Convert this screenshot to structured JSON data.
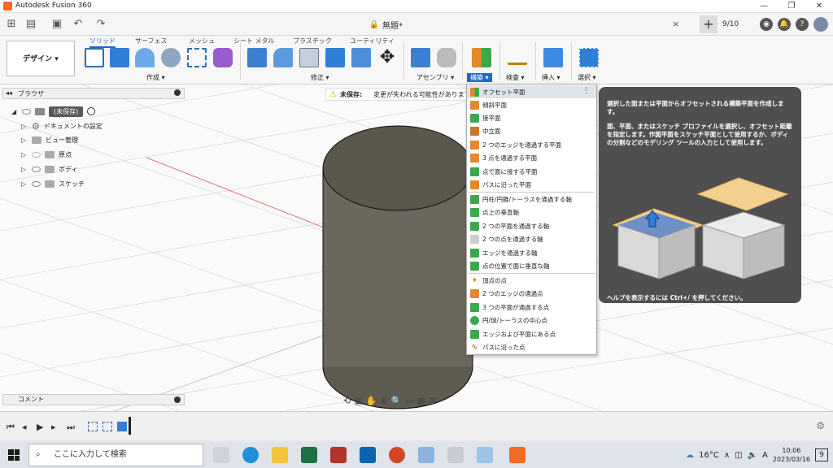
{
  "titlebar": {
    "app_title": "Autodesk Fusion 360",
    "minimize": "—",
    "restore": "❐",
    "close": "✕"
  },
  "quick_access": {
    "doc_title": "無題*",
    "doc_close": "×",
    "job_status": "9/10"
  },
  "ribbon": {
    "workspace": "デザイン ▾",
    "tabs": [
      "ソリッド",
      "サーフェス",
      "メッシュ",
      "シート メタル",
      "プラスチック",
      "ユーティリティ"
    ],
    "groups": {
      "create": "作成 ▾",
      "modify": "修正 ▾",
      "assemble": "アセンブリ ▾",
      "construct": "構築 ▾",
      "inspect": "検査 ▾",
      "insert": "挿入 ▾",
      "select": "選択 ▾"
    }
  },
  "browser": {
    "title": "ブラウザ",
    "root": "(未保存)",
    "items": [
      "ドキュメントの設定",
      "ビュー管理",
      "原点",
      "ボディ",
      "スケッチ"
    ]
  },
  "warning": {
    "label": "未保存:",
    "text": "変更が失われる可能性があります"
  },
  "construct_menu": {
    "items": [
      "オフセット平面",
      "傾斜平面",
      "接平面",
      "中立面",
      "2 つのエッジを通過する平面",
      "3 点を通過する平面",
      "点で面に接する平面",
      "パスに沿った平面",
      "円柱/円錐/トーラスを通過する軸",
      "点上の垂直軸",
      "2 つの平面を通過する軸",
      "2 つの点を通過する軸",
      "エッジを通過する軸",
      "点の位置で面に垂直な軸",
      "頂点の点",
      "2 つのエッジの通過点",
      "3 つの平面が通過する点",
      "円/球/トーラスの中心点",
      "エッジおよび平面にある点",
      "パスに沿った点"
    ]
  },
  "tooltip": {
    "line1": "選択した面または平面からオフセットされる構築平面を作成します。",
    "line2": "面、平面、またはスケッチ プロファイルを選択し、オフセット距離を指定します。作図平面をスケッチ平面として使用するか、ボディの分割などのモデリング ツールの入力として使用します。",
    "help": "ヘルプを表示するには Ctrl+/ を押してください。"
  },
  "comment": {
    "label": "コメント"
  },
  "taskbar": {
    "search_placeholder": "ここに入力して検索",
    "weather": "16°C",
    "ime": "A",
    "time": "10:06",
    "date": "2023/03/16",
    "notifications": "9"
  }
}
